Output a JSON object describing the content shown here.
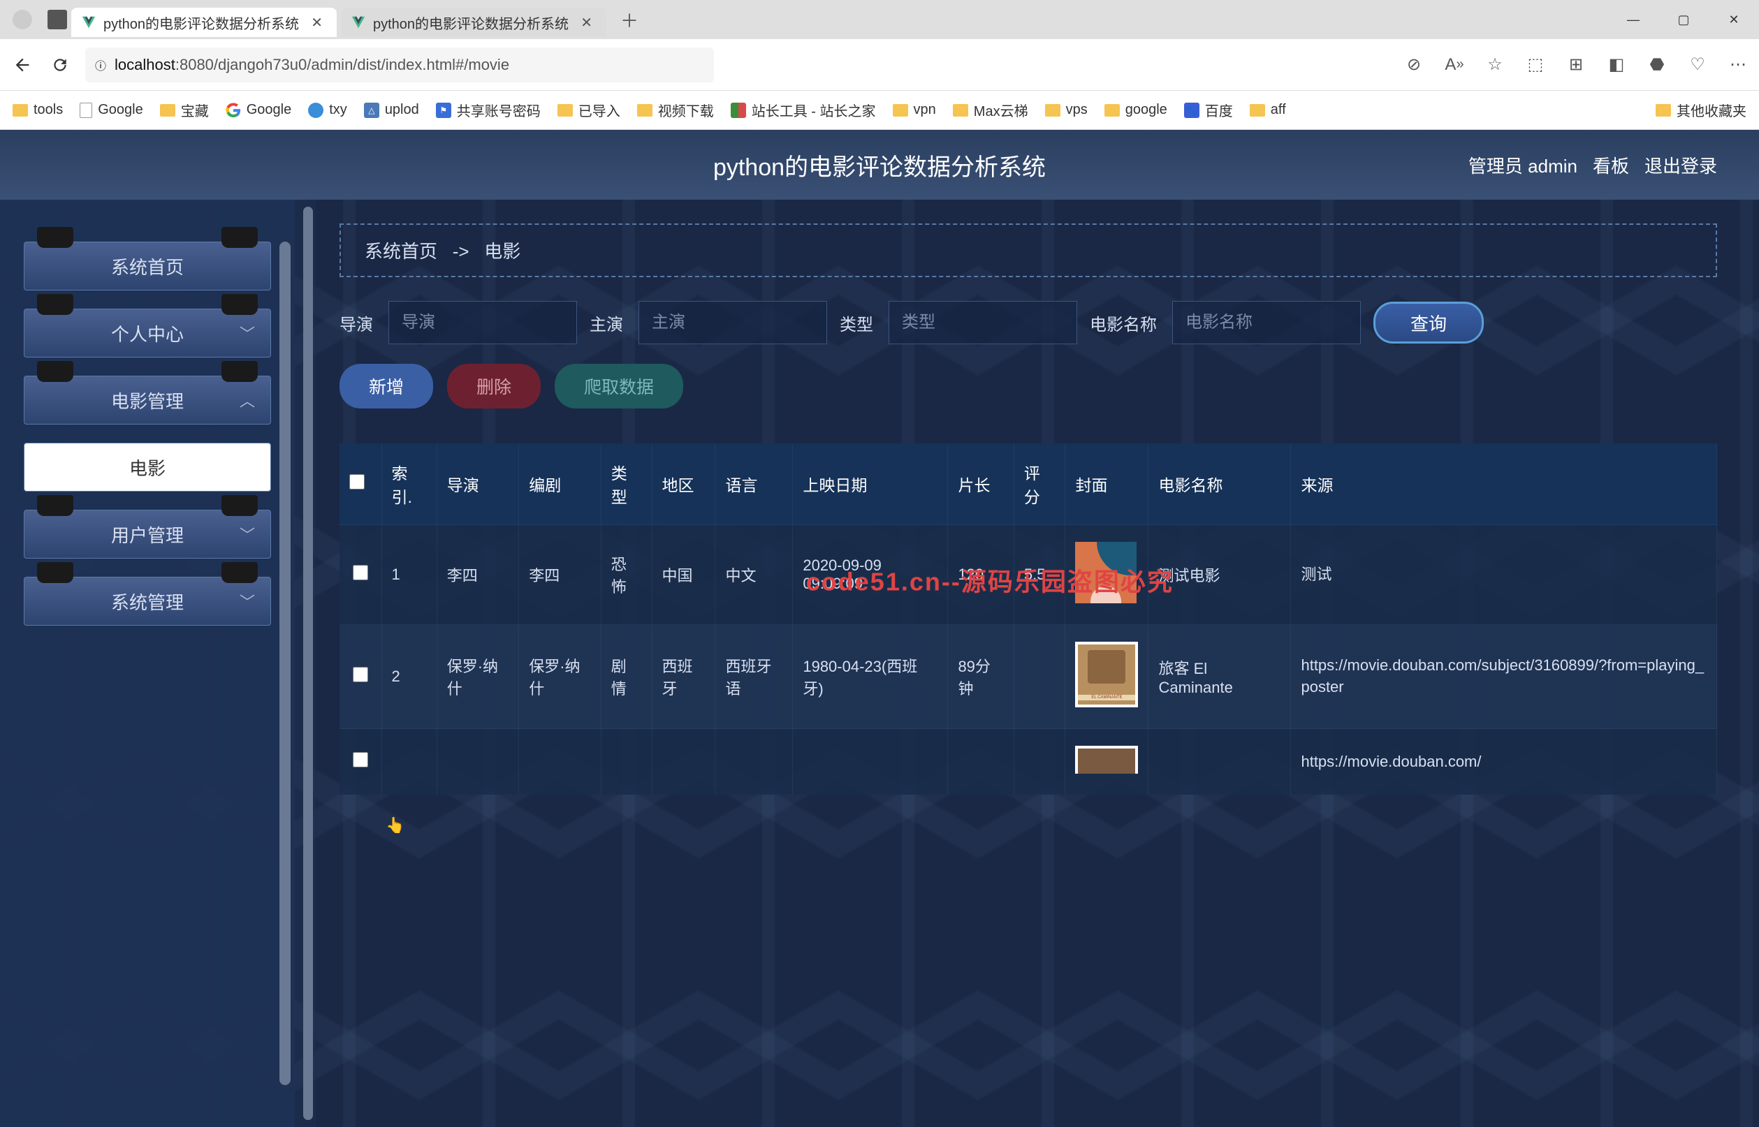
{
  "browser": {
    "tabs": [
      {
        "title": "python的电影评论数据分析系统",
        "active": true
      },
      {
        "title": "python的电影评论数据分析系统",
        "active": false
      }
    ],
    "url_host": "localhost",
    "url_path": ":8080/djangoh73u0/admin/dist/index.html#/movie",
    "bookmarks": [
      {
        "label": "tools",
        "type": "folder"
      },
      {
        "label": "Google",
        "type": "doc"
      },
      {
        "label": "宝藏",
        "type": "folder"
      },
      {
        "label": "Google",
        "type": "google"
      },
      {
        "label": "txy",
        "type": "blueround"
      },
      {
        "label": "uplod",
        "type": "blue"
      },
      {
        "label": "共享账号密码",
        "type": "blueflag"
      },
      {
        "label": "已导入",
        "type": "folder"
      },
      {
        "label": "视频下载",
        "type": "folder"
      },
      {
        "label": "站长工具 - 站长之家",
        "type": "chart"
      },
      {
        "label": "vpn",
        "type": "folder"
      },
      {
        "label": "Max云梯",
        "type": "folder"
      },
      {
        "label": "vps",
        "type": "folder"
      },
      {
        "label": "google",
        "type": "folder"
      },
      {
        "label": "百度",
        "type": "paw"
      },
      {
        "label": "aff",
        "type": "folder"
      }
    ],
    "bookmark_right": "其他收藏夹"
  },
  "header": {
    "title": "python的电影评论数据分析系统",
    "user_label": "管理员 admin",
    "kanban": "看板",
    "logout": "退出登录"
  },
  "sidebar": {
    "items": [
      {
        "label": "系统首页",
        "expandable": false
      },
      {
        "label": "个人中心",
        "expandable": true,
        "expanded": false
      },
      {
        "label": "电影管理",
        "expandable": true,
        "expanded": true
      },
      {
        "label": "电影",
        "active": true
      },
      {
        "label": "用户管理",
        "expandable": true,
        "expanded": false
      },
      {
        "label": "系统管理",
        "expandable": true,
        "expanded": false
      }
    ]
  },
  "breadcrumb": {
    "home": "系统首页",
    "sep": "->",
    "current": "电影"
  },
  "search": {
    "fields": [
      {
        "label": "导演",
        "placeholder": "导演"
      },
      {
        "label": "主演",
        "placeholder": "主演"
      },
      {
        "label": "类型",
        "placeholder": "类型"
      },
      {
        "label": "电影名称",
        "placeholder": "电影名称"
      }
    ],
    "button": "查询"
  },
  "actions": {
    "add": "新增",
    "delete": "删除",
    "crawl": "爬取数据"
  },
  "table": {
    "headers": [
      "索引.",
      "导演",
      "编剧",
      "类型",
      "地区",
      "语言",
      "上映日期",
      "片长",
      "评分",
      "封面",
      "电影名称",
      "来源"
    ],
    "rows": [
      {
        "index": "1",
        "director": "李四",
        "writer": "李四",
        "genre": "恐怖",
        "region": "中国",
        "lang": "中文",
        "date": "2020-09-09 09:09:09",
        "duration": "120",
        "rating": "5.5",
        "cover": "c1",
        "name": "测试电影",
        "source": "测试"
      },
      {
        "index": "2",
        "director": "保罗·纳什",
        "writer": "保罗·纳什",
        "genre": "剧情",
        "region": "西班牙",
        "lang": "西班牙语",
        "date": "1980-04-23(西班牙)",
        "duration": "89分钟",
        "rating": "",
        "cover": "c2",
        "name": "旅客 El Caminante",
        "source": "https://movie.douban.com/subject/3160899/?from=playing_poster"
      },
      {
        "index": "",
        "director": "",
        "writer": "",
        "genre": "",
        "region": "",
        "lang": "",
        "date": "",
        "duration": "",
        "rating": "",
        "cover": "c3",
        "name": "",
        "source": "https://movie.douban.com/"
      }
    ]
  },
  "overlay_text": "code51.cn--源码乐园盗图必究"
}
